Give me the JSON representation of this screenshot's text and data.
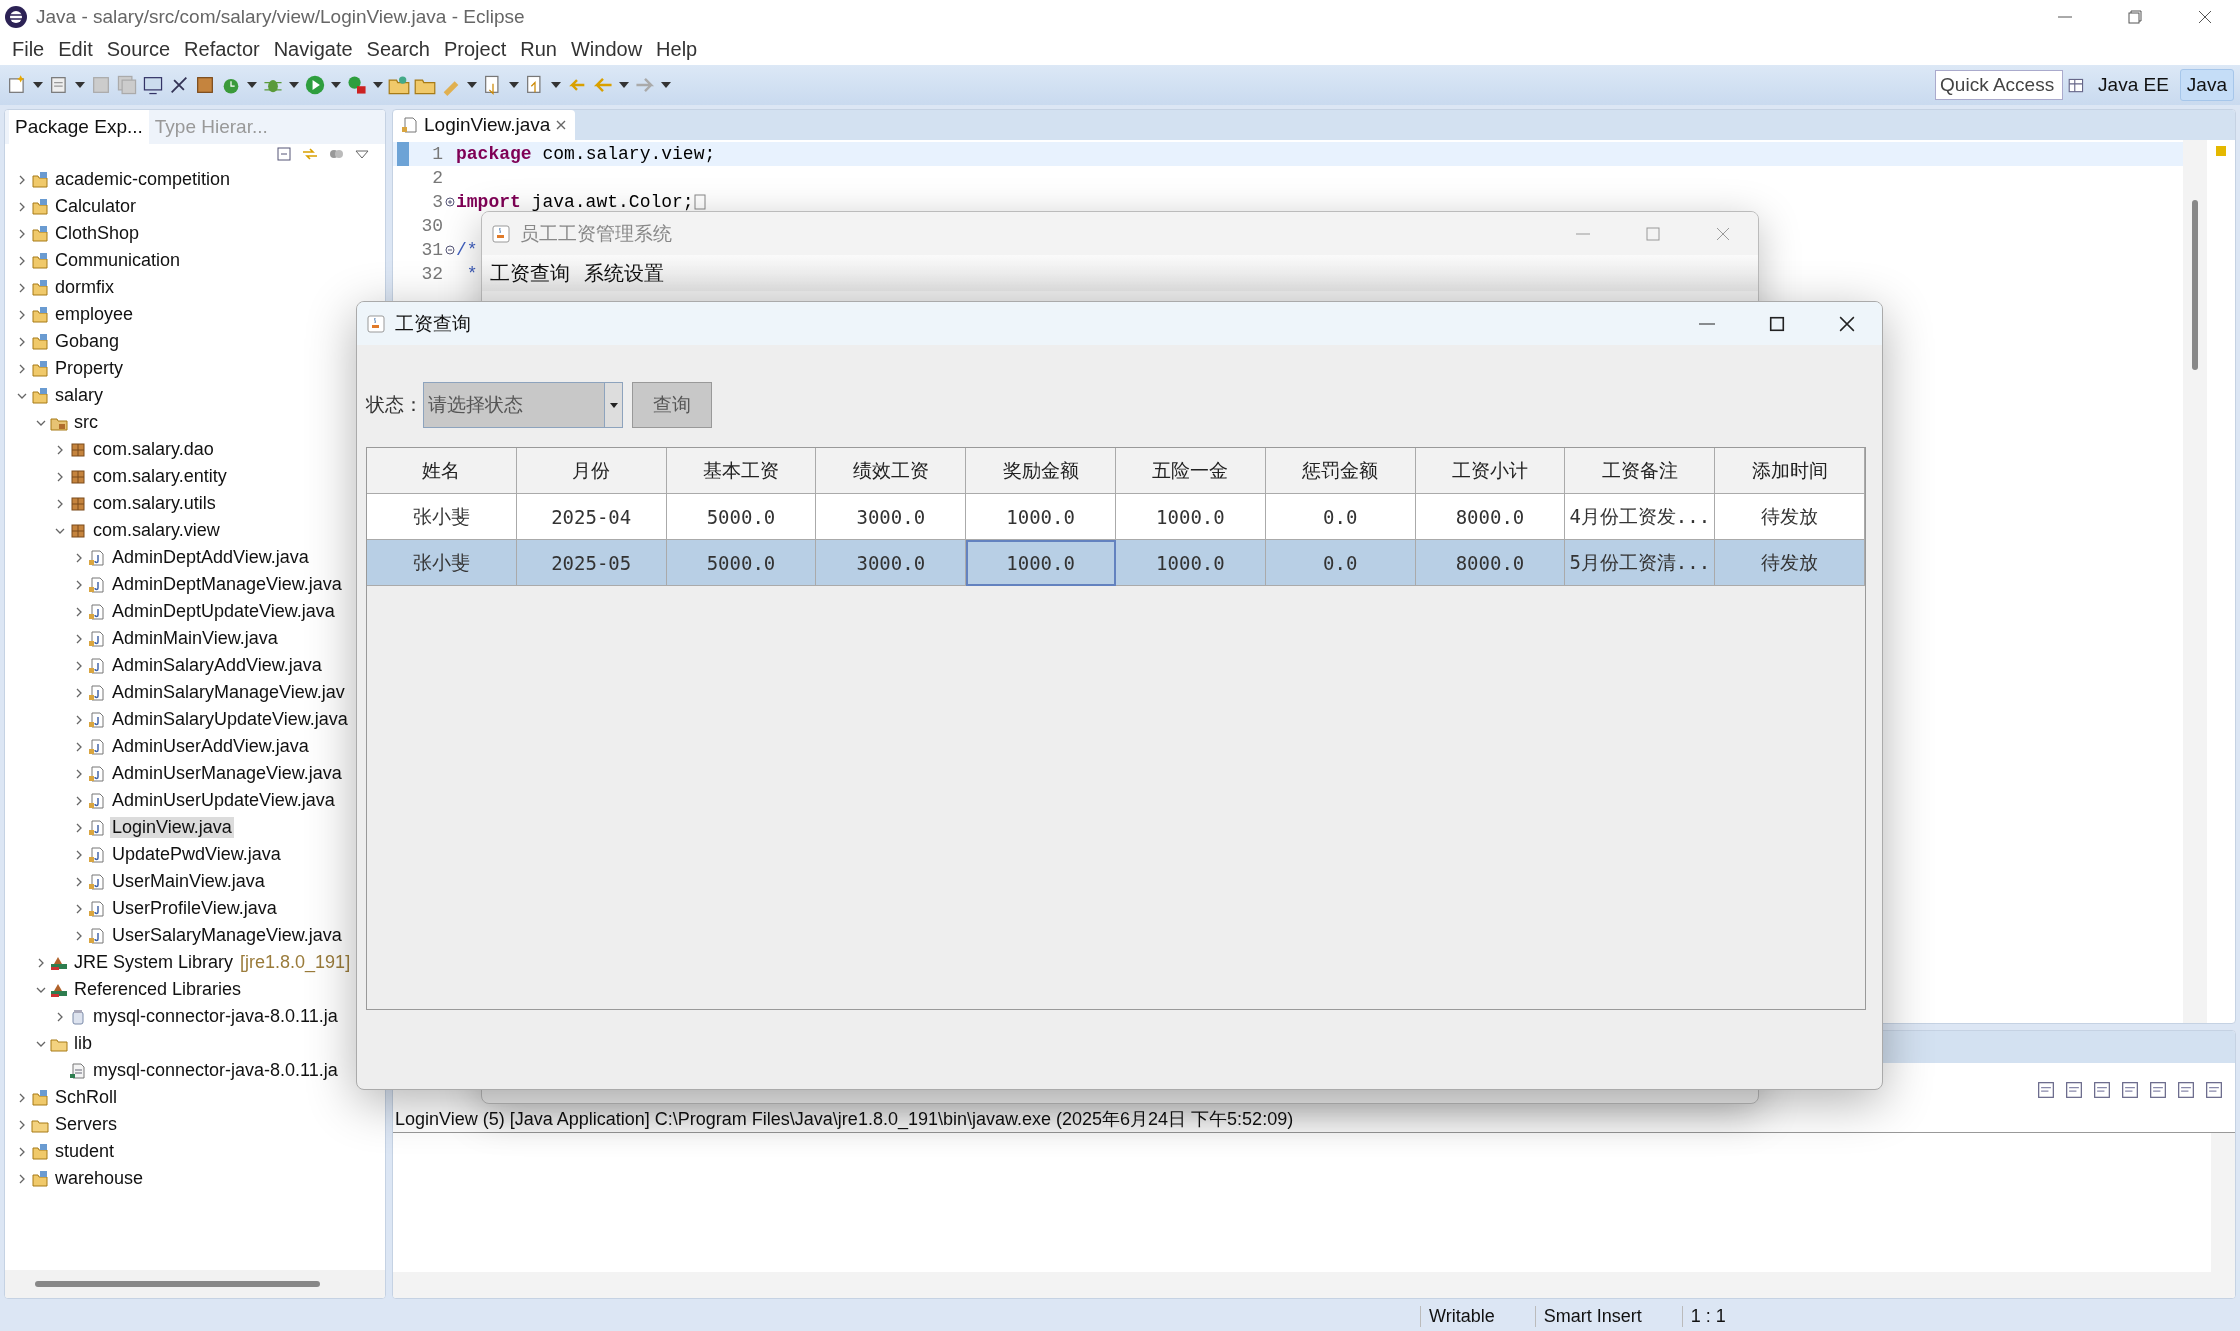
{
  "window": {
    "title": "Java - salary/src/com/salary/view/LoginView.java - Eclipse"
  },
  "menu": [
    "File",
    "Edit",
    "Source",
    "Refactor",
    "Navigate",
    "Search",
    "Project",
    "Run",
    "Window",
    "Help"
  ],
  "quick_access": {
    "placeholder": "Quick Access"
  },
  "perspectives": [
    {
      "label": "Java EE",
      "selected": false
    },
    {
      "label": "Java",
      "selected": true
    }
  ],
  "explorer": {
    "tabs": [
      {
        "label": "Package Exp...",
        "selected": true
      },
      {
        "label": "Type Hierar...",
        "selected": false
      }
    ],
    "tree": [
      {
        "label": "academic-competition",
        "kind": "project",
        "expanded": false,
        "selected": false
      },
      {
        "label": "Calculator",
        "kind": "project",
        "expanded": false,
        "selected": false
      },
      {
        "label": "ClothShop",
        "kind": "project",
        "expanded": false,
        "selected": false
      },
      {
        "label": "Communication",
        "kind": "project",
        "expanded": false,
        "selected": false
      },
      {
        "label": "dormfix",
        "kind": "project",
        "expanded": false,
        "selected": false
      },
      {
        "label": "employee",
        "kind": "project",
        "expanded": false,
        "selected": false
      },
      {
        "label": "Gobang",
        "kind": "project",
        "expanded": false,
        "selected": false
      },
      {
        "label": "Property",
        "kind": "project",
        "expanded": false,
        "selected": false
      },
      {
        "label": "salary",
        "kind": "project",
        "expanded": true,
        "selected": false,
        "children": [
          {
            "label": "src",
            "kind": "src",
            "expanded": true,
            "selected": false,
            "children": [
              {
                "label": "com.salary.dao",
                "kind": "package",
                "expanded": false,
                "selected": false
              },
              {
                "label": "com.salary.entity",
                "kind": "package",
                "expanded": false,
                "selected": false
              },
              {
                "label": "com.salary.utils",
                "kind": "package",
                "expanded": false,
                "selected": false
              },
              {
                "label": "com.salary.view",
                "kind": "package",
                "expanded": true,
                "selected": false,
                "children": [
                  {
                    "label": "AdminDeptAddView.java",
                    "kind": "file",
                    "expanded": false,
                    "selected": false
                  },
                  {
                    "label": "AdminDeptManageView.java",
                    "kind": "file",
                    "expanded": false,
                    "selected": false
                  },
                  {
                    "label": "AdminDeptUpdateView.java",
                    "kind": "file",
                    "expanded": false,
                    "selected": false
                  },
                  {
                    "label": "AdminMainView.java",
                    "kind": "file",
                    "expanded": false,
                    "selected": false
                  },
                  {
                    "label": "AdminSalaryAddView.java",
                    "kind": "file",
                    "expanded": false,
                    "selected": false
                  },
                  {
                    "label": "AdminSalaryManageView.jav",
                    "kind": "file",
                    "expanded": false,
                    "selected": false
                  },
                  {
                    "label": "AdminSalaryUpdateView.java",
                    "kind": "file",
                    "expanded": false,
                    "selected": false
                  },
                  {
                    "label": "AdminUserAddView.java",
                    "kind": "file",
                    "expanded": false,
                    "selected": false
                  },
                  {
                    "label": "AdminUserManageView.java",
                    "kind": "file",
                    "expanded": false,
                    "selected": false
                  },
                  {
                    "label": "AdminUserUpdateView.java",
                    "kind": "file",
                    "expanded": false,
                    "selected": false
                  },
                  {
                    "label": "LoginView.java",
                    "kind": "file",
                    "expanded": false,
                    "selected": true
                  },
                  {
                    "label": "UpdatePwdView.java",
                    "kind": "file",
                    "expanded": false,
                    "selected": false
                  },
                  {
                    "label": "UserMainView.java",
                    "kind": "file",
                    "expanded": false,
                    "selected": false
                  },
                  {
                    "label": "UserProfileView.java",
                    "kind": "file",
                    "expanded": false,
                    "selected": false
                  },
                  {
                    "label": "UserSalaryManageView.java",
                    "kind": "file",
                    "expanded": false,
                    "selected": false
                  }
                ]
              }
            ]
          },
          {
            "label": "JRE System Library",
            "suffix": "[jre1.8.0_191]",
            "kind": "library",
            "expanded": false,
            "selected": false
          },
          {
            "label": "Referenced Libraries",
            "kind": "library",
            "expanded": true,
            "selected": false,
            "children": [
              {
                "label": "mysql-connector-java-8.0.11.ja",
                "kind": "jar",
                "expanded": false,
                "selected": false
              }
            ]
          },
          {
            "label": "lib",
            "kind": "folder",
            "expanded": true,
            "selected": false,
            "children": [
              {
                "label": "mysql-connector-java-8.0.11.ja",
                "kind": "jarfile",
                "selected": false
              }
            ]
          }
        ]
      },
      {
        "label": "SchRoll",
        "kind": "project",
        "expanded": false,
        "selected": false
      },
      {
        "label": "Servers",
        "kind": "folder",
        "expanded": false,
        "selected": false
      },
      {
        "label": "student",
        "kind": "project",
        "expanded": false,
        "selected": false
      },
      {
        "label": "warehouse",
        "kind": "project",
        "expanded": false,
        "selected": false
      }
    ]
  },
  "editor": {
    "tab": {
      "label": "LoginView.java"
    },
    "lines": [
      {
        "number": "1",
        "current": true,
        "segments": [
          {
            "kind": "keyword",
            "text": "package"
          },
          {
            "kind": "plain",
            "text": " com.salary.view;"
          }
        ]
      },
      {
        "number": "2",
        "current": false
      },
      {
        "number": "3",
        "current": false,
        "collapsed": true,
        "segments": [
          {
            "kind": "keyword",
            "text": "import"
          },
          {
            "kind": "plain",
            "text": " java.awt.Color;"
          }
        ]
      },
      {
        "number": "30",
        "current": false
      },
      {
        "number": "31",
        "current": false,
        "collapsed": false,
        "segments": [
          {
            "kind": "comment",
            "text": "/*"
          }
        ]
      },
      {
        "number": "32",
        "current": false,
        "segments": [
          {
            "kind": "comment",
            "text": " *"
          }
        ]
      }
    ]
  },
  "back_window": {
    "title": "员工工资管理系统",
    "menu": [
      "工资查询",
      "系统设置"
    ]
  },
  "dialog": {
    "title": "工资查询",
    "filter": {
      "label": "状态：",
      "value": "请选择状态",
      "button": "查询"
    },
    "table": {
      "columns": [
        "姓名",
        "月份",
        "基本工资",
        "绩效工资",
        "奖励金额",
        "五险一金",
        "惩罚金额",
        "工资小计",
        "工资备注",
        "添加时间"
      ],
      "rows": [
        {
          "selected": false,
          "cells": [
            {
              "text": "张小斐",
              "focused": false
            },
            {
              "text": "2025-04",
              "focused": false
            },
            {
              "text": "5000.0",
              "focused": false
            },
            {
              "text": "3000.0",
              "focused": false
            },
            {
              "text": "1000.0",
              "focused": false
            },
            {
              "text": "1000.0",
              "focused": false
            },
            {
              "text": "0.0",
              "focused": false
            },
            {
              "text": "8000.0",
              "focused": false
            },
            {
              "text": "4月份工资发...",
              "focused": false
            },
            {
              "text": "待发放",
              "focused": false
            }
          ]
        },
        {
          "selected": true,
          "cells": [
            {
              "text": "张小斐",
              "focused": false
            },
            {
              "text": "2025-05",
              "focused": false
            },
            {
              "text": "5000.0",
              "focused": false
            },
            {
              "text": "3000.0",
              "focused": false
            },
            {
              "text": "1000.0",
              "focused": true
            },
            {
              "text": "1000.0",
              "focused": false
            },
            {
              "text": "0.0",
              "focused": false
            },
            {
              "text": "8000.0",
              "focused": false
            },
            {
              "text": "5月份工资清...",
              "focused": false
            },
            {
              "text": "待发放",
              "focused": false
            }
          ]
        }
      ]
    }
  },
  "console": {
    "header": "LoginView (5) [Java Application] C:\\Program Files\\Java\\jre1.8.0_191\\bin\\javaw.exe (2025年6月24日 下午5:52:09)"
  },
  "status_bar": [
    "Writable",
    "Smart Insert",
    "1 : 1"
  ]
}
